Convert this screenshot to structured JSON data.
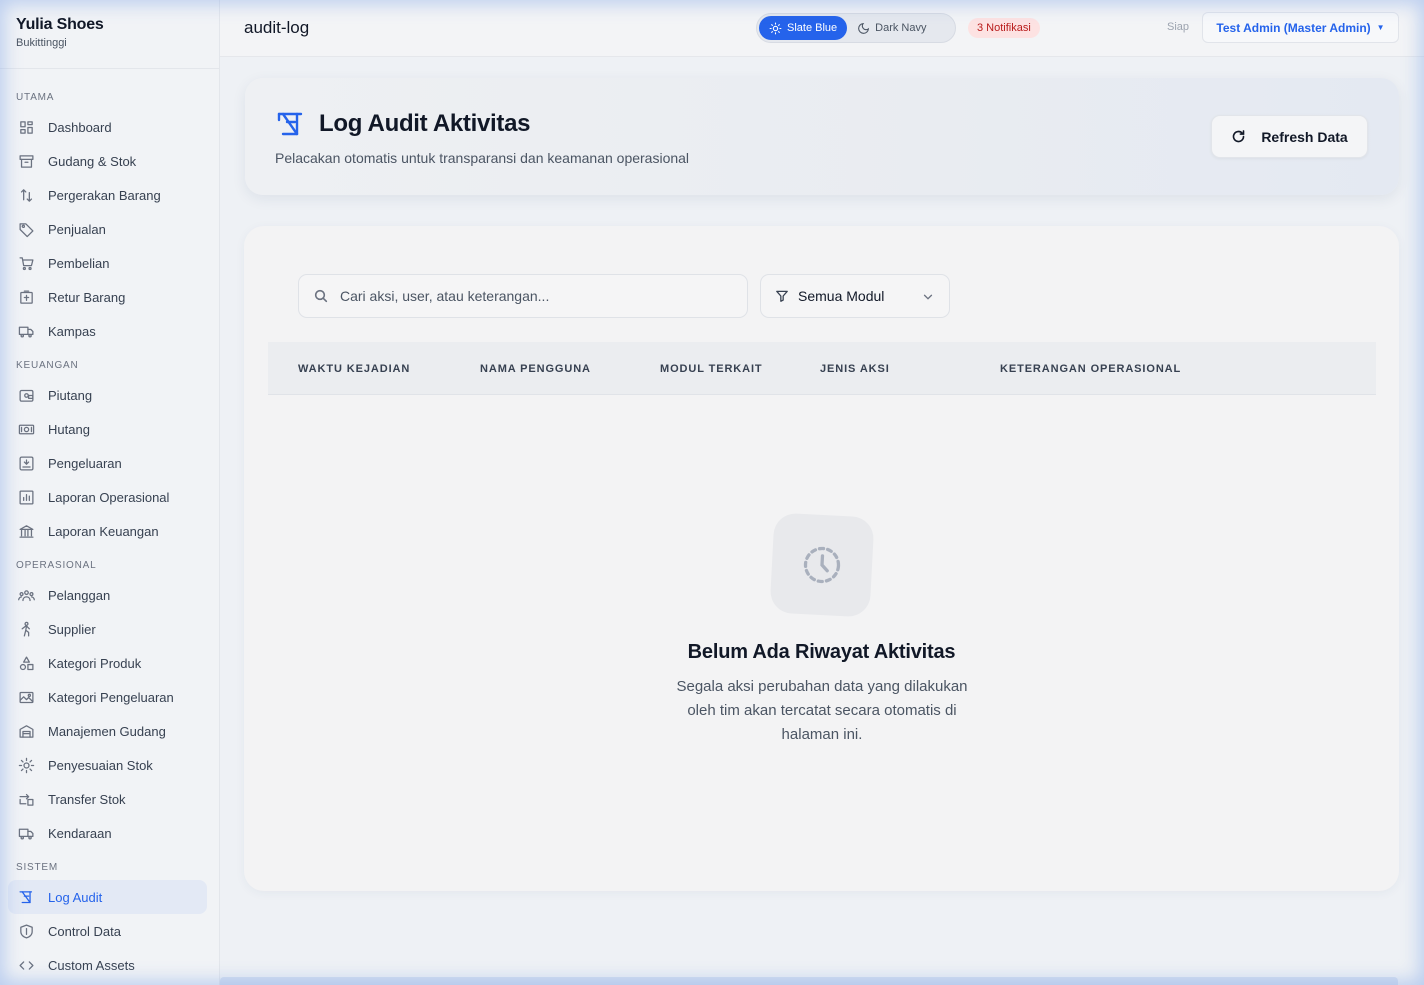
{
  "brand": {
    "name": "Yulia Shoes",
    "location": "Bukittinggi"
  },
  "sidebar": {
    "sections": [
      {
        "label": "UTAMA",
        "items": [
          {
            "label": "Dashboard",
            "icon": "grid-icon"
          },
          {
            "label": "Gudang & Stok",
            "icon": "archive-icon"
          },
          {
            "label": "Pergerakan Barang",
            "icon": "arrows-updown-icon"
          },
          {
            "label": "Penjualan",
            "icon": "tag-icon"
          },
          {
            "label": "Pembelian",
            "icon": "cart-icon"
          },
          {
            "label": "Retur Barang",
            "icon": "return-box-icon"
          },
          {
            "label": "Kampas",
            "icon": "truck-icon"
          }
        ]
      },
      {
        "label": "KEUANGAN",
        "items": [
          {
            "label": "Piutang",
            "icon": "wallet-icon"
          },
          {
            "label": "Hutang",
            "icon": "money-icon"
          },
          {
            "label": "Pengeluaran",
            "icon": "expense-icon"
          },
          {
            "label": "Laporan Operasional",
            "icon": "chart-icon"
          },
          {
            "label": "Laporan Keuangan",
            "icon": "bank-icon"
          }
        ]
      },
      {
        "label": "OPERASIONAL",
        "items": [
          {
            "label": "Pelanggan",
            "icon": "users-icon"
          },
          {
            "label": "Supplier",
            "icon": "supplier-icon"
          },
          {
            "label": "Kategori Produk",
            "icon": "shapes-icon"
          },
          {
            "label": "Kategori Pengeluaran",
            "icon": "image-icon"
          },
          {
            "label": "Manajemen Gudang",
            "icon": "warehouse-icon"
          },
          {
            "label": "Penyesuaian Stok",
            "icon": "gear-icon"
          },
          {
            "label": "Transfer Stok",
            "icon": "transfer-icon"
          },
          {
            "label": "Kendaraan",
            "icon": "truck-icon"
          }
        ]
      },
      {
        "label": "SISTEM",
        "items": [
          {
            "label": "Log Audit",
            "icon": "audit-icon",
            "active": true
          },
          {
            "label": "Control Data",
            "icon": "shield-icon"
          },
          {
            "label": "Custom Assets",
            "icon": "code-icon"
          }
        ]
      }
    ]
  },
  "topbar": {
    "slug": "audit-log",
    "themes": [
      {
        "label": "Slate Blue",
        "active": true
      },
      {
        "label": "Dark Navy",
        "active": false
      }
    ],
    "notifications": "3 Notifikasi",
    "status": "Siap",
    "user": "Test Admin (Master Admin)"
  },
  "header": {
    "title": "Log Audit Aktivitas",
    "subtitle": "Pelacakan otomatis untuk transparansi dan keamanan operasional",
    "refresh_label": "Refresh Data"
  },
  "filters": {
    "search_placeholder": "Cari aksi, user, atau keterangan...",
    "module_selected": "Semua Modul"
  },
  "table": {
    "columns": [
      "WAKTU KEJADIAN",
      "NAMA PENGGUNA",
      "MODUL TERKAIT",
      "JENIS AKSI",
      "KETERANGAN OPERASIONAL"
    ]
  },
  "empty_state": {
    "title": "Belum Ada Riwayat Aktivitas",
    "description": "Segala aksi perubahan data yang dilakukan oleh tim akan tercatat secara otomatis di halaman ini."
  },
  "colors": {
    "accent": "#2563eb",
    "danger_bg": "#fde2e2",
    "danger_text": "#b91c1c"
  }
}
